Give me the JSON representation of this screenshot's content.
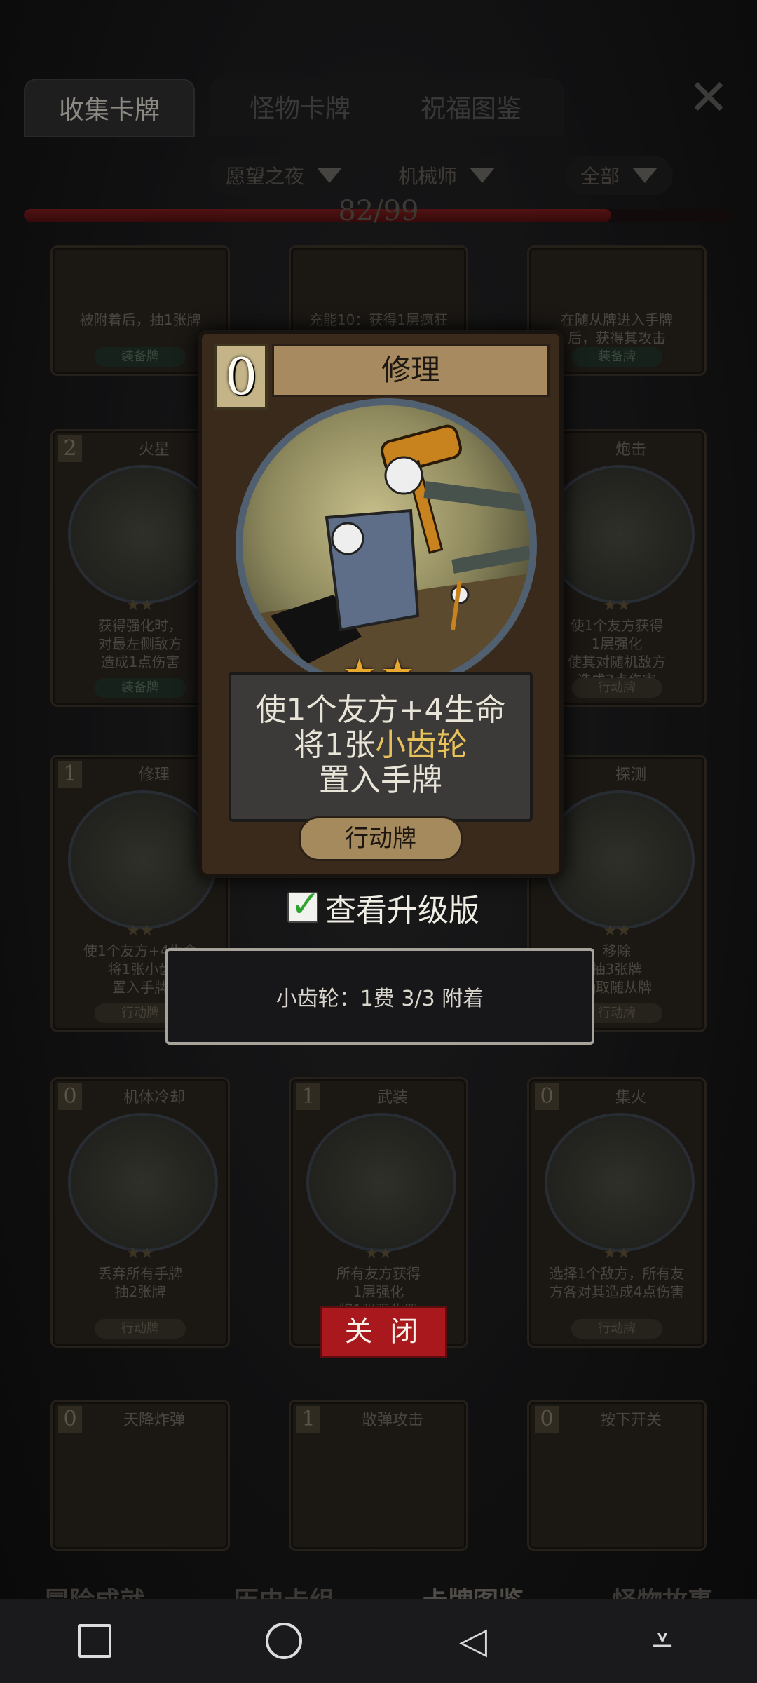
{
  "tabs": [
    {
      "label": "收集卡牌",
      "active": true
    },
    {
      "label": "怪物卡牌",
      "active": false
    },
    {
      "label": "祝福图鉴",
      "active": false
    }
  ],
  "filters": [
    "愿望之夜",
    "机械师",
    "全部"
  ],
  "progress": {
    "text": "82/99",
    "fraction": 0.828
  },
  "grid_cards": [
    {
      "cost": "",
      "name": "",
      "desc": [
        "被附着后，抽1张牌"
      ],
      "type": "装备牌"
    },
    {
      "cost": "",
      "name": "",
      "desc": [
        "充能10：获得1层疯狂"
      ],
      "type": ""
    },
    {
      "cost": "",
      "name": "",
      "desc": [
        "在随从牌进入手牌",
        "后，获得其攻击"
      ],
      "type": "装备牌"
    },
    {
      "cost": "2",
      "name": "火星",
      "desc": [
        "获得强化时，",
        "对最左侧敌方",
        "造成1点伤害"
      ],
      "type": "装备牌"
    },
    {
      "cost": "",
      "name": "炮击",
      "desc": [
        "使1个友方获得",
        "1层强化",
        "使其对随机敌方",
        "造成3点伤害"
      ],
      "type": "行动牌"
    },
    {
      "cost": "1",
      "name": "修理",
      "desc": [
        "使1个友方+4生命",
        "将1张小齿",
        "置入手牌"
      ],
      "type": "行动牌"
    },
    {
      "cost": "",
      "name": "探测",
      "desc": [
        "移除",
        "抽3张牌",
        "抽取随从牌"
      ],
      "type": "行动牌"
    },
    {
      "cost": "0",
      "name": "机体冷却",
      "desc": [
        "丢弃所有手牌",
        "抽2张牌"
      ],
      "type": "行动牌"
    },
    {
      "cost": "1",
      "name": "武装",
      "desc": [
        "所有友方获得",
        "1层强化",
        "将1张强化器"
      ],
      "type": ""
    },
    {
      "cost": "0",
      "name": "集火",
      "desc": [
        "选择1个敌方，所有友",
        "方各对其造成4点伤害"
      ],
      "type": "行动牌"
    },
    {
      "cost": "0",
      "name": "天降炸弹",
      "desc": [],
      "type": ""
    },
    {
      "cost": "1",
      "name": "散弹攻击",
      "desc": [],
      "type": ""
    },
    {
      "cost": "0",
      "name": "按下开关",
      "desc": [],
      "type": ""
    }
  ],
  "detail_card": {
    "cost": "0",
    "name": "修理",
    "stars": "★★",
    "desc_line1": "使1个友方+4生命",
    "desc_line2_pre": "将1张",
    "desc_line2_gold": "小齿轮",
    "desc_line3": "置入手牌",
    "type": "行动牌"
  },
  "upgrade_label": "查看升级版",
  "tooltip_text": "小齿轮：1费 3/3 附着",
  "close_label": "关 闭",
  "bottom_menu": [
    "冒险成就",
    "历史卡组",
    "卡牌图鉴",
    "怪物故事"
  ],
  "colors": {
    "accent_gold": "#e7c25a",
    "close_red": "#a8181c",
    "progress_red": "#7c1d1d"
  }
}
